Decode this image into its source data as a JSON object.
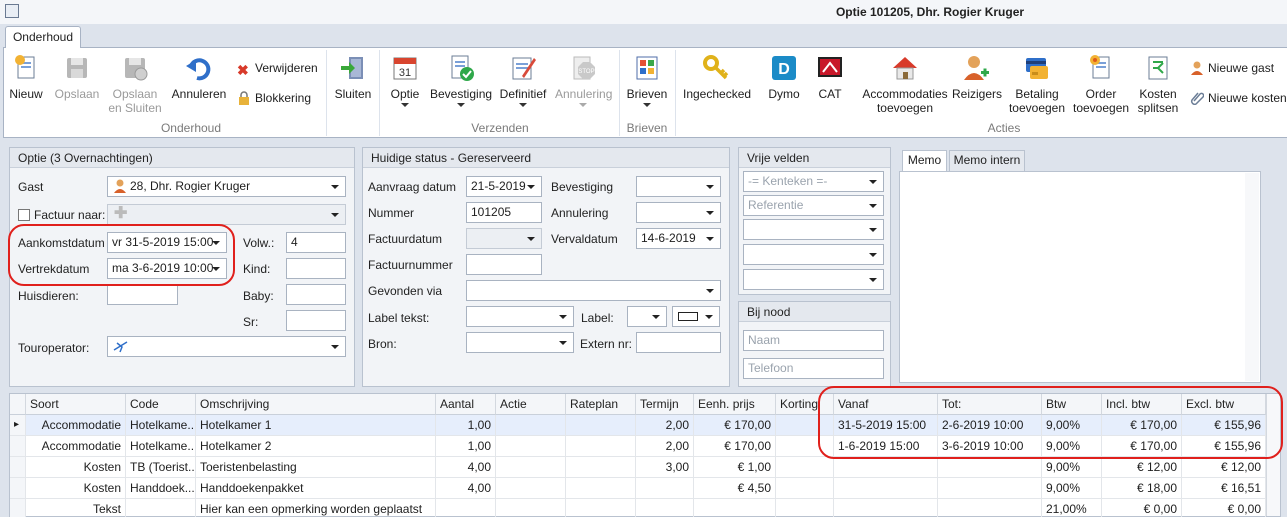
{
  "window": {
    "title": "Optie 101205, Dhr. Rogier Kruger"
  },
  "ribbon": {
    "tab": "Onderhoud",
    "buttons": {
      "nieuw": "Nieuw",
      "opslaan": "Opslaan",
      "opslaan_sluiten": "Opslaan en Sluiten",
      "annuleren": "Annuleren",
      "verwijderen": "Verwijderen",
      "blokkering": "Blokkering",
      "sluiten": "Sluiten",
      "optie": "Optie",
      "bevestiging": "Bevestiging",
      "definitief": "Definitief",
      "annulering": "Annulering",
      "brieven": "Brieven",
      "ingechecked": "Ingechecked",
      "dymo": "Dymo",
      "cat": "CAT",
      "accommodaties_toevoegen": "Accommodaties toevoegen",
      "reizigers": "Reizigers",
      "betaling_toevoegen": "Betaling toevoegen",
      "order_toevoegen": "Order toevoegen",
      "kosten_splitsen": "Kosten splitsen",
      "nieuwe_gast": "Nieuwe gast",
      "nieuwe_kosten": "Nieuwe kosten"
    },
    "groups": {
      "onderhoud": "Onderhoud",
      "verzenden": "Verzenden",
      "brieven": "Brieven",
      "acties": "Acties"
    }
  },
  "optie": {
    "header": "Optie (3 Overnachtingen)",
    "gast_label": "Gast",
    "gast_value": "28, Dhr. Rogier Kruger",
    "factuur_label": "Factuur naar:",
    "aankomst_label": "Aankomstdatum",
    "aankomst_value": "vr 31-5-2019 15:00",
    "vertrek_label": "Vertrekdatum",
    "vertrek_value": "ma 3-6-2019 10:00",
    "huisdieren_label": "Huisdieren:",
    "touroperator_label": "Touroperator:",
    "volw_label": "Volw.:",
    "volw_value": "4",
    "kind_label": "Kind:",
    "baby_label": "Baby:",
    "sr_label": "Sr:"
  },
  "status": {
    "header": "Huidige status - Gereserveerd",
    "aanvraagdatum_label": "Aanvraag datum",
    "aanvraagdatum_value": "21-5-2019",
    "nummer_label": "Nummer",
    "nummer_value": "101205",
    "factuurdatum_label": "Factuurdatum",
    "factuurnummer_label": "Factuurnummer",
    "gevonden_label": "Gevonden via",
    "labeltekst_label": "Label tekst:",
    "bron_label": "Bron:",
    "bevestiging_label": "Bevestiging",
    "annulering_label": "Annulering",
    "vervaldatum_label": "Vervaldatum",
    "vervaldatum_value": "14-6-2019",
    "label_label": "Label:",
    "extern_label": "Extern nr:"
  },
  "vrije_velden": {
    "header": "Vrije velden",
    "kenteken_placeholder": "-= Kenteken =-",
    "referentie_placeholder": "Referentie"
  },
  "bij_nood": {
    "header": "Bij nood",
    "naam_placeholder": "Naam",
    "telefoon_placeholder": "Telefoon"
  },
  "memo": {
    "tab1": "Memo",
    "tab2": "Memo intern"
  },
  "grid": {
    "columns": [
      "Soort",
      "Code",
      "Omschrijving",
      "Aantal",
      "Actie",
      "Rateplan",
      "Termijn",
      "Eenh. prijs",
      "Korting",
      "Vanaf",
      "Tot:",
      "Btw",
      "Incl. btw",
      "Excl. btw"
    ],
    "rows": [
      [
        "Accommodatie",
        "Hotelkame...",
        "Hotelkamer 1",
        "1,00",
        "",
        "",
        "2,00",
        "€ 170,00",
        "",
        "31-5-2019 15:00",
        "2-6-2019 10:00",
        "9,00%",
        "€ 170,00",
        "€ 155,96"
      ],
      [
        "Accommodatie",
        "Hotelkame...",
        "Hotelkamer 2",
        "1,00",
        "",
        "",
        "2,00",
        "€ 170,00",
        "",
        "1-6-2019 15:00",
        "3-6-2019 10:00",
        "9,00%",
        "€ 170,00",
        "€ 155,96"
      ],
      [
        "Kosten",
        "TB (Toerist...",
        "Toeristenbelasting",
        "4,00",
        "",
        "",
        "3,00",
        "€ 1,00",
        "",
        "",
        "",
        "9,00%",
        "€ 12,00",
        "€ 12,00"
      ],
      [
        "Kosten",
        "Handdoek...",
        "Handdoekenpakket",
        "4,00",
        "",
        "",
        "",
        "€ 4,50",
        "",
        "",
        "",
        "9,00%",
        "€ 18,00",
        "€ 16,51"
      ],
      [
        "Tekst",
        "",
        "Hier kan een opmerking worden geplaatst",
        "",
        "",
        "",
        "",
        "",
        "",
        "",
        "",
        "21,00%",
        "€ 0,00",
        "€ 0,00"
      ]
    ]
  },
  "colors": {
    "highlight": "#e0201c",
    "selected_row": "#e6eefc"
  }
}
